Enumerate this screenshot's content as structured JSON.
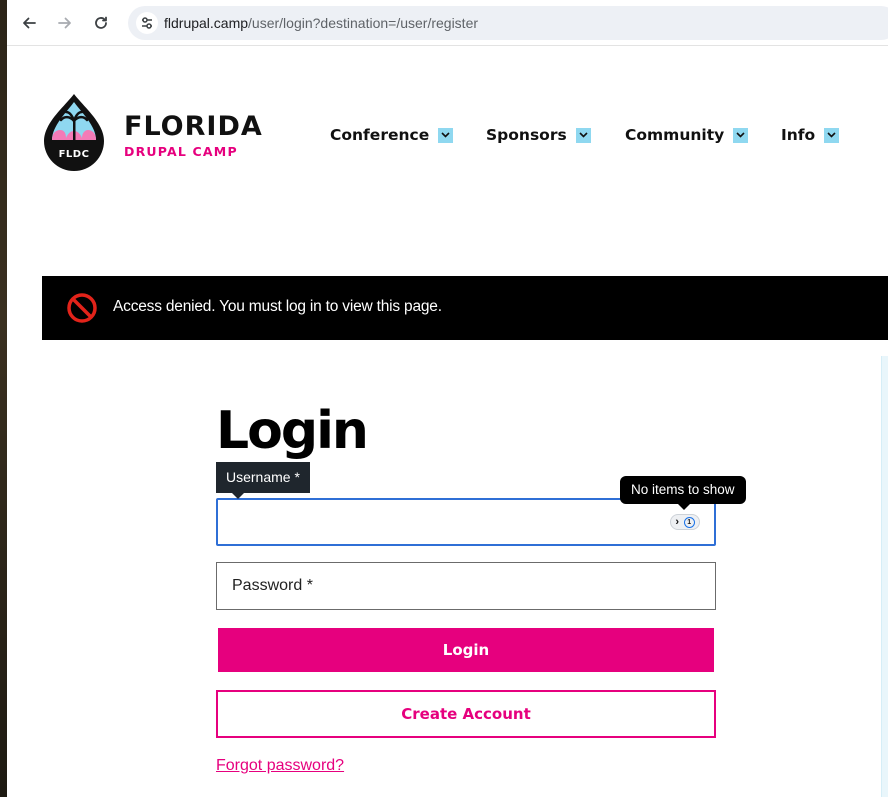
{
  "browser": {
    "url_host": "fldrupal.camp",
    "url_path": "/user/login?destination=/user/register"
  },
  "site": {
    "logo_badge": "FLDC",
    "logo_title": "FLORIDA",
    "logo_subtitle": "DRUPAL CAMP",
    "nav": [
      {
        "label": "Conference"
      },
      {
        "label": "Sponsors"
      },
      {
        "label": "Community"
      },
      {
        "label": "Info"
      }
    ]
  },
  "alert": {
    "message": "Access denied. You must log in to view this page."
  },
  "login": {
    "title": "Login",
    "username_label": "Username *",
    "password_placeholder": "Password *",
    "login_button": "Login",
    "create_account_button": "Create Account",
    "forgot_link": "Forgot password?"
  },
  "password_manager": {
    "tooltip": "No items to show"
  },
  "colors": {
    "brand_pink": "#e6007e",
    "nav_caret": "#8fd8f0",
    "alert_bg": "#000000"
  }
}
